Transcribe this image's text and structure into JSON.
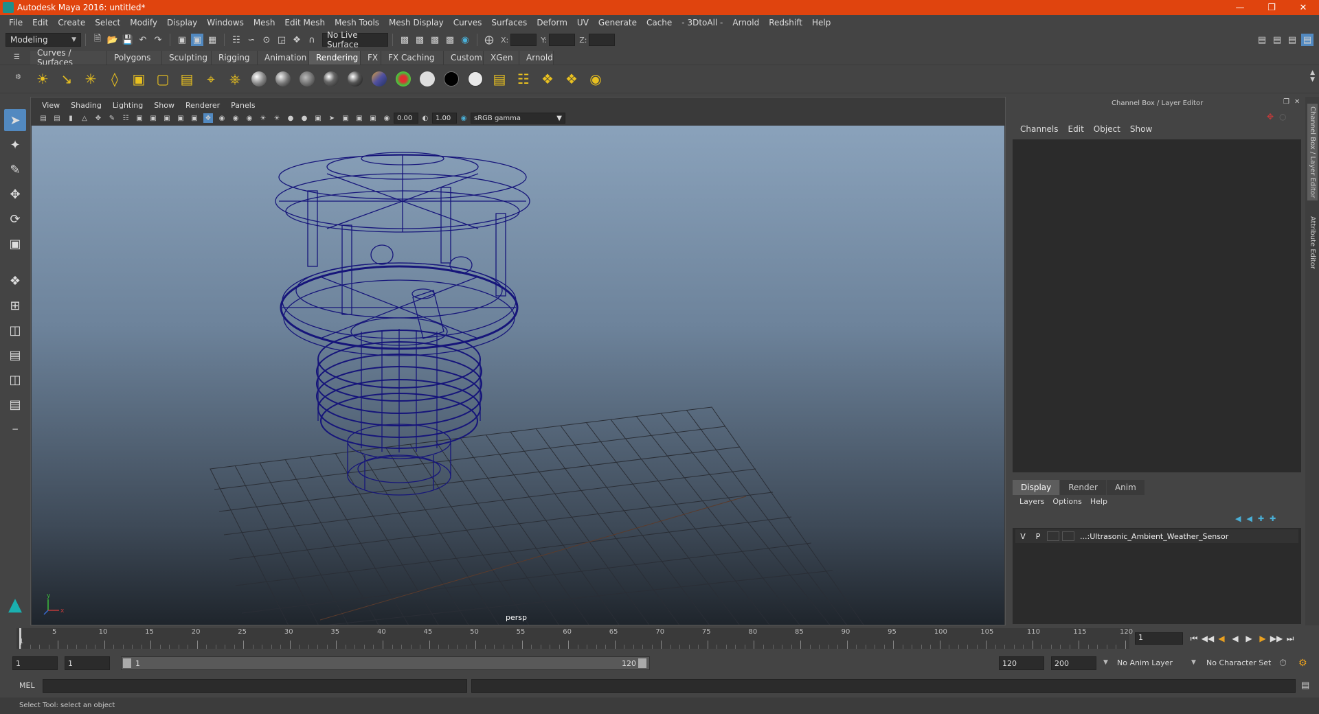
{
  "app": {
    "title": "Autodesk Maya 2016: untitled*"
  },
  "menubar": [
    "File",
    "Edit",
    "Create",
    "Select",
    "Modify",
    "Display",
    "Windows",
    "Mesh",
    "Edit Mesh",
    "Mesh Tools",
    "Mesh Display",
    "Curves",
    "Surfaces",
    "Deform",
    "UV",
    "Generate",
    "Cache",
    "- 3DtoAll -",
    "Arnold",
    "Redshift",
    "Help"
  ],
  "statusline": {
    "mode": "Modeling",
    "live_surface": "No Live Surface",
    "x_label": "X:",
    "y_label": "Y:",
    "z_label": "Z:"
  },
  "shelf_tabs": [
    "Curves / Surfaces",
    "Polygons",
    "Sculpting",
    "Rigging",
    "Animation",
    "Rendering",
    "FX",
    "FX Caching",
    "Custom",
    "XGen",
    "Arnold"
  ],
  "shelf_active": "Rendering",
  "viewport": {
    "menus": [
      "View",
      "Shading",
      "Lighting",
      "Show",
      "Renderer",
      "Panels"
    ],
    "exposure": "0.00",
    "gamma": "1.00",
    "color_space": "sRGB gamma",
    "camera": "persp",
    "axis_x": "x",
    "axis_y": "y"
  },
  "right_panel": {
    "title": "Channel Box / Layer Editor",
    "cb_menus": [
      "Channels",
      "Edit",
      "Object",
      "Show"
    ],
    "layer_tabs": [
      "Display",
      "Render",
      "Anim"
    ],
    "layer_active": "Display",
    "layer_menus": [
      "Layers",
      "Options",
      "Help"
    ],
    "layer": {
      "v": "V",
      "p": "P",
      "name": "...:Ultrasonic_Ambient_Weather_Sensor"
    },
    "side_tabs": [
      "Channel Box / Layer Editor",
      "Attribute Editor"
    ]
  },
  "timeslider": {
    "start": "1",
    "ticks": [
      "5",
      "10",
      "15",
      "20",
      "25",
      "30",
      "35",
      "40",
      "45",
      "50",
      "55",
      "60",
      "65",
      "70",
      "75",
      "80",
      "85",
      "90",
      "95",
      "100",
      "105",
      "110",
      "115",
      "120"
    ],
    "current_frame": "1"
  },
  "rangeslider": {
    "start": "1",
    "anim_start": "1",
    "range_start": "1",
    "range_end": "120",
    "end": "120",
    "anim_end": "200",
    "anim_layer": "No Anim Layer",
    "char_set": "No Character Set"
  },
  "cmdline": {
    "label": "MEL"
  },
  "helpline": {
    "text": "Select Tool: select an object"
  }
}
